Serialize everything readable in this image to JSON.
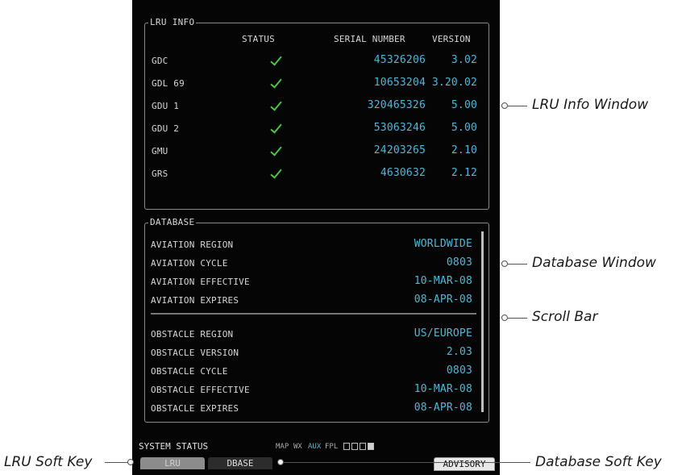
{
  "lru_panel": {
    "title": "LRU INFO",
    "headers": [
      "STATUS",
      "SERIAL NUMBER",
      "VERSION"
    ],
    "rows": [
      {
        "name": "GDC",
        "serial": "45326206",
        "version": "3.02"
      },
      {
        "name": "GDL 69",
        "serial": "10653204",
        "version": "3.20.02"
      },
      {
        "name": "GDU 1",
        "serial": "320465326",
        "version": "5.00"
      },
      {
        "name": "GDU 2",
        "serial": "53063246",
        "version": "5.00"
      },
      {
        "name": "GMU",
        "serial": "24203265",
        "version": "2.10"
      },
      {
        "name": "GRS",
        "serial": "4630632",
        "version": "2.12"
      }
    ],
    "status_icon": "checkmark-icon"
  },
  "database_panel": {
    "title": "DATABASE",
    "aviation": [
      {
        "label": "AVIATION REGION",
        "value": "WORLDWIDE"
      },
      {
        "label": "AVIATION CYCLE",
        "value": "0803"
      },
      {
        "label": "AVIATION EFFECTIVE",
        "value": "10-MAR-08"
      },
      {
        "label": "AVIATION EXPIRES",
        "value": "08-APR-08"
      }
    ],
    "obstacle": [
      {
        "label": "OBSTACLE REGION",
        "value": "US/EUROPE"
      },
      {
        "label": "OBSTACLE VERSION",
        "value": "2.03"
      },
      {
        "label": "OBSTACLE CYCLE",
        "value": "0803"
      },
      {
        "label": "OBSTACLE EFFECTIVE",
        "value": "10-MAR-08"
      },
      {
        "label": "OBSTACLE EXPIRES",
        "value": "08-APR-08"
      }
    ]
  },
  "status_bar": {
    "title": "SYSTEM STATUS",
    "page_groups": [
      "MAP",
      "WX",
      "AUX",
      "FPL"
    ],
    "active_group": "AUX"
  },
  "softkeys": {
    "lru": "LRU",
    "dbase": "DBASE",
    "advisory": "ADVISORY"
  },
  "callouts": {
    "lru_info_window": "LRU Info Window",
    "database_window": "Database Window",
    "scroll_bar": "Scroll Bar",
    "lru_soft_key": "LRU Soft Key",
    "database_soft_key": "Database Soft Key"
  },
  "colors": {
    "value_cyan": "#4fb8d8",
    "check_green": "#4cc447",
    "screen_bg": "#050505"
  }
}
